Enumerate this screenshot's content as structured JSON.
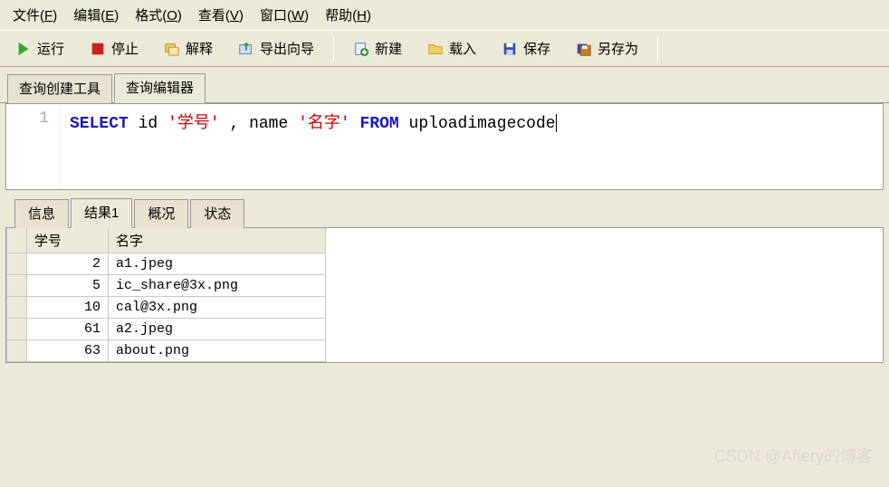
{
  "menus": {
    "file": {
      "text": "文件",
      "accel": "F"
    },
    "edit": {
      "text": "编辑",
      "accel": "E"
    },
    "format": {
      "text": "格式",
      "accel": "O"
    },
    "view": {
      "text": "查看",
      "accel": "V"
    },
    "window": {
      "text": "窗口",
      "accel": "W"
    },
    "help": {
      "text": "帮助",
      "accel": "H"
    }
  },
  "toolbar": {
    "run": "运行",
    "stop": "停止",
    "explain": "解释",
    "export_wizard": "导出向导",
    "new": "新建",
    "load": "载入",
    "save": "保存",
    "save_as": "另存为"
  },
  "editor_tabs": {
    "builder": "查询创建工具",
    "editor": "查询编辑器"
  },
  "sql": {
    "line_no": "1",
    "kw_select": "SELECT",
    "col1": "id",
    "alias1": "'学号'",
    "comma": " , ",
    "col2": "name",
    "alias2": "'名字'",
    "kw_from": "FROM",
    "table": "uploadimagecode"
  },
  "result_tabs": {
    "info": "信息",
    "result1": "结果1",
    "profile": "概况",
    "status": "状态"
  },
  "columns": {
    "c1": "学号",
    "c2": "名字"
  },
  "rows": [
    {
      "id": "2",
      "name": "a1.jpeg"
    },
    {
      "id": "5",
      "name": "ic_share@3x.png"
    },
    {
      "id": "10",
      "name": "cal@3x.png"
    },
    {
      "id": "61",
      "name": "a2.jpeg"
    },
    {
      "id": "63",
      "name": "about.png"
    }
  ],
  "watermark": "CSDN @Aftery的博客"
}
